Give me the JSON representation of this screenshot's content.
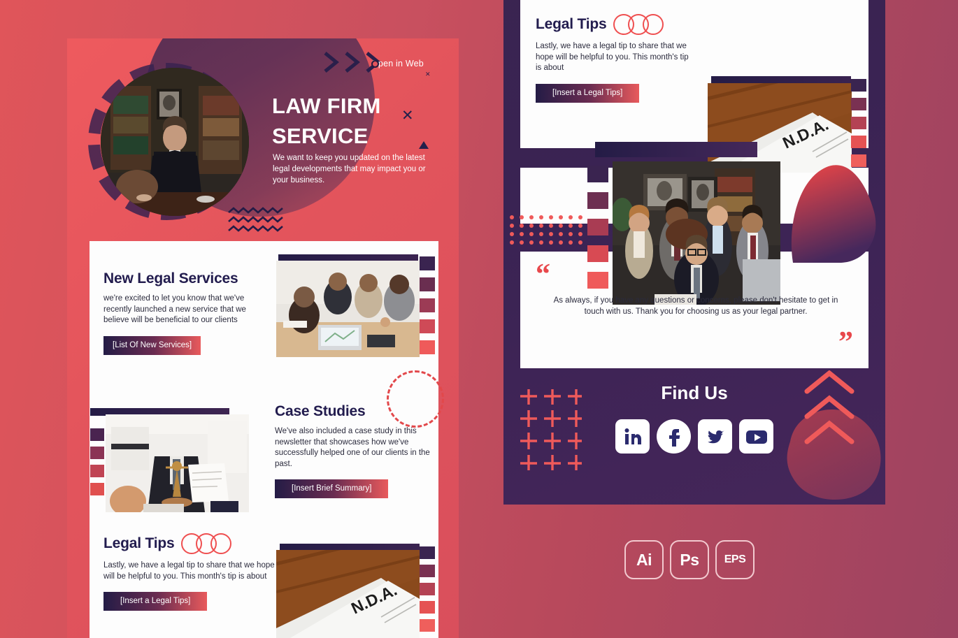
{
  "hero": {
    "link_label": "Open in Web",
    "title_line1": "LAW FIRM",
    "title_line2": "SERVICE",
    "subtitle": "We want to keep you updated on the latest legal developments that may impact you or your business."
  },
  "sections": [
    {
      "title": "New Legal Services",
      "body": "we're excited to let you know that we've recently launched a new service that we believe will be beneficial to our clients",
      "button": "[List Of New Services]"
    },
    {
      "title": "Case Studies",
      "body": "We've also included a case study in this newsletter that showcases how we've successfully helped one of our clients in the past.",
      "button": "[Insert Brief Summary]"
    },
    {
      "title": "Legal Tips",
      "body": "Lastly, we have a legal tip to share that we hope will be helpful to you. This month's tip is about",
      "button": "[Insert a Legal Tips]"
    }
  ],
  "page_right": {
    "legal_tips": {
      "title": "Legal Tips",
      "body": "Lastly, we have a legal tip to share that we hope will be helpful to you. This month's tip is about",
      "button": "[Insert a Legal Tips]"
    },
    "quote": {
      "open_mark": "“",
      "close_mark": "”",
      "text": "As always, if you have any questions or concerns, please don't hesitate to get in touch with us. Thank you for choosing us as your legal partner."
    },
    "find_us": {
      "title": "Find Us",
      "socials": [
        "linkedin-icon",
        "facebook-icon",
        "twitter-icon",
        "youtube-icon"
      ]
    }
  },
  "badges": [
    {
      "label": "Ai"
    },
    {
      "label": "Ps"
    },
    {
      "label": "EPS"
    }
  ],
  "colors": {
    "coral": "#e85a5c",
    "navy": "#241c46",
    "purple": "#3b2450",
    "page_bg": "#c9505f"
  }
}
